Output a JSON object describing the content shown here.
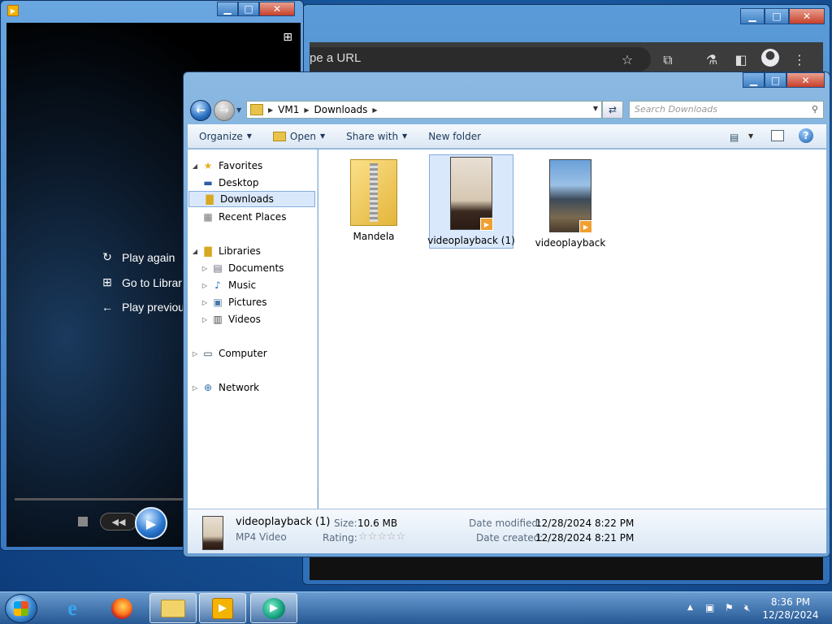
{
  "chrome": {
    "omnibox_text": "pe a URL",
    "icons": [
      "star-icon",
      "extension-icon",
      "labs-icon",
      "side-panel-icon",
      "profile-icon",
      "more-icon"
    ]
  },
  "wmp": {
    "menu": [
      {
        "label": "Play again",
        "icon": "replay-icon"
      },
      {
        "label": "Go to Librar",
        "icon": "library-icon"
      },
      {
        "label": "Play previou",
        "icon": "back-arrow-icon"
      }
    ]
  },
  "explorer": {
    "breadcrumb": [
      "VM1",
      "Downloads"
    ],
    "search_placeholder": "Search Downloads",
    "commands": {
      "organize": "Organize",
      "open": "Open",
      "share_with": "Share with",
      "new_folder": "New folder"
    },
    "nav": {
      "favorites": "Favorites",
      "desktop": "Desktop",
      "downloads": "Downloads",
      "recent_places": "Recent Places",
      "libraries": "Libraries",
      "documents": "Documents",
      "music": "Music",
      "pictures": "Pictures",
      "videos": "Videos",
      "computer": "Computer",
      "network": "Network"
    },
    "files": [
      {
        "name": "Mandela",
        "type": "zip"
      },
      {
        "name": "videoplayback (1)",
        "type": "video",
        "selected": true
      },
      {
        "name": "videoplayback",
        "type": "video"
      }
    ],
    "details": {
      "name": "videoplayback (1)",
      "type": "MP4 Video",
      "size_label": "Size:",
      "size": "10.6 MB",
      "rating_label": "Rating:",
      "rating": 0,
      "modified_label": "Date modified:",
      "modified": "12/28/2024 8:22 PM",
      "created_label": "Date created:",
      "created": "12/28/2024 8:21 PM"
    }
  },
  "taskbar": {
    "time": "8:36 PM",
    "date": "12/28/2024"
  }
}
